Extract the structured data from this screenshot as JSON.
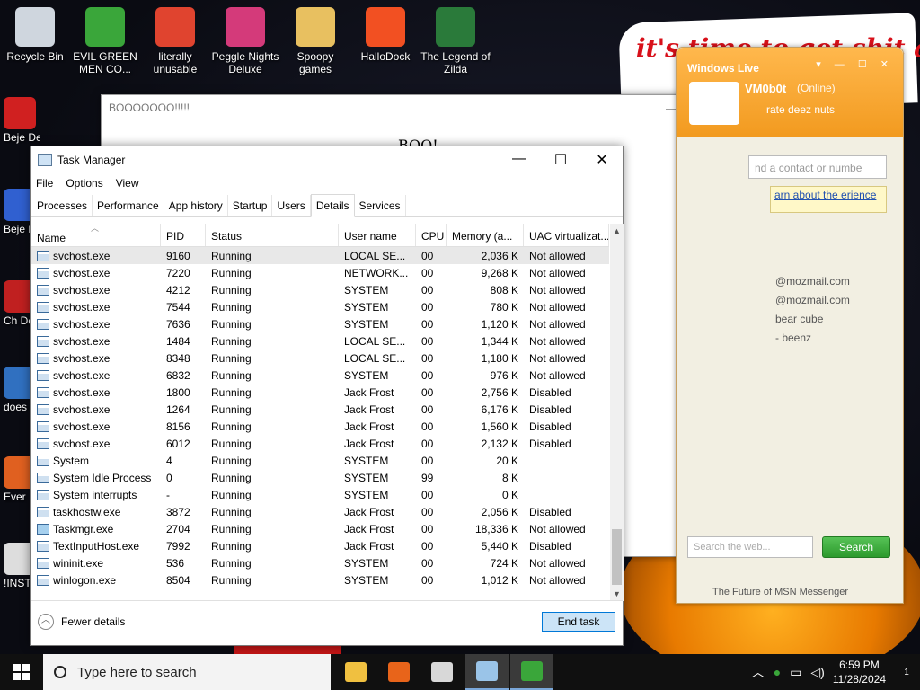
{
  "desktop": {
    "wallpaper_text": "it's time to get shit and",
    "icons": [
      {
        "label": "Recycle Bin",
        "icon": "recycle-bin-icon",
        "color": "#cfd6de"
      },
      {
        "label": "EVIL GREEN MEN CO...",
        "icon": "msn-buddies-icon",
        "color": "#3aa63a"
      },
      {
        "label": "literally unusable",
        "icon": "chrome-icon",
        "color": "#e0442f"
      },
      {
        "label": "Peggle Nights Deluxe",
        "icon": "peggle-icon",
        "color": "#d43a7a"
      },
      {
        "label": "Spoopy games",
        "icon": "folder-icon",
        "color": "#e8c060"
      },
      {
        "label": "HalloDock",
        "icon": "windows-logo-icon",
        "color": "#f25022"
      },
      {
        "label": "The Legend of Zilda",
        "icon": "zilda-icon",
        "color": "#2a7a3a"
      }
    ],
    "left_icons": [
      {
        "label": "Beje De",
        "icon": "bejeweled-icon",
        "color": "#d02020"
      },
      {
        "label": "Beje De",
        "icon": "bejeweled2-icon",
        "color": "#3060d0"
      },
      {
        "label": "Ch De",
        "icon": "chuzzle-icon",
        "color": "#c02020"
      },
      {
        "label": "does",
        "icon": "app-icon",
        "color": "#3070c0"
      },
      {
        "label": "Ever",
        "icon": "game-icon",
        "color": "#e06020"
      },
      {
        "label": "!INST",
        "icon": "installer-icon",
        "color": "#ddd"
      }
    ]
  },
  "boo_window": {
    "title": "BOOOOOOO!!!!!",
    "body": "BOO!",
    "controls": [
      "—",
      "☐",
      "✕"
    ]
  },
  "msn": {
    "brand": "Windows Live",
    "username": "VM0b0t",
    "status": "(Online)",
    "personal_message": "rate deez nuts",
    "search_placeholder": "nd a contact or numbe",
    "notice": "arn about the erience",
    "contacts": [
      "@mozmail.com",
      "@mozmail.com",
      "bear cube",
      "",
      "- beenz"
    ],
    "web_search_placeholder": "Search the web...",
    "search_button": "Search",
    "footer": "The Future of MSN Messenger"
  },
  "task_manager": {
    "title": "Task Manager",
    "menu": [
      "File",
      "Options",
      "View"
    ],
    "tabs": [
      "Processes",
      "Performance",
      "App history",
      "Startup",
      "Users",
      "Details",
      "Services"
    ],
    "active_tab": "Details",
    "columns": [
      "Name",
      "PID",
      "Status",
      "User name",
      "CPU",
      "Memory (a...",
      "UAC virtualizat..."
    ],
    "rows": [
      {
        "name": "svchost.exe",
        "pid": "9160",
        "status": "Running",
        "user": "LOCAL SE...",
        "cpu": "00",
        "mem": "2,036 K",
        "uac": "Not allowed",
        "selected": true
      },
      {
        "name": "svchost.exe",
        "pid": "7220",
        "status": "Running",
        "user": "NETWORK...",
        "cpu": "00",
        "mem": "9,268 K",
        "uac": "Not allowed"
      },
      {
        "name": "svchost.exe",
        "pid": "4212",
        "status": "Running",
        "user": "SYSTEM",
        "cpu": "00",
        "mem": "808 K",
        "uac": "Not allowed"
      },
      {
        "name": "svchost.exe",
        "pid": "7544",
        "status": "Running",
        "user": "SYSTEM",
        "cpu": "00",
        "mem": "780 K",
        "uac": "Not allowed"
      },
      {
        "name": "svchost.exe",
        "pid": "7636",
        "status": "Running",
        "user": "SYSTEM",
        "cpu": "00",
        "mem": "1,120 K",
        "uac": "Not allowed"
      },
      {
        "name": "svchost.exe",
        "pid": "1484",
        "status": "Running",
        "user": "LOCAL SE...",
        "cpu": "00",
        "mem": "1,344 K",
        "uac": "Not allowed"
      },
      {
        "name": "svchost.exe",
        "pid": "8348",
        "status": "Running",
        "user": "LOCAL SE...",
        "cpu": "00",
        "mem": "1,180 K",
        "uac": "Not allowed"
      },
      {
        "name": "svchost.exe",
        "pid": "6832",
        "status": "Running",
        "user": "SYSTEM",
        "cpu": "00",
        "mem": "976 K",
        "uac": "Not allowed"
      },
      {
        "name": "svchost.exe",
        "pid": "1800",
        "status": "Running",
        "user": "Jack Frost",
        "cpu": "00",
        "mem": "2,756 K",
        "uac": "Disabled"
      },
      {
        "name": "svchost.exe",
        "pid": "1264",
        "status": "Running",
        "user": "Jack Frost",
        "cpu": "00",
        "mem": "6,176 K",
        "uac": "Disabled"
      },
      {
        "name": "svchost.exe",
        "pid": "8156",
        "status": "Running",
        "user": "Jack Frost",
        "cpu": "00",
        "mem": "1,560 K",
        "uac": "Disabled"
      },
      {
        "name": "svchost.exe",
        "pid": "6012",
        "status": "Running",
        "user": "Jack Frost",
        "cpu": "00",
        "mem": "2,132 K",
        "uac": "Disabled"
      },
      {
        "name": "System",
        "pid": "4",
        "status": "Running",
        "user": "SYSTEM",
        "cpu": "00",
        "mem": "20 K",
        "uac": ""
      },
      {
        "name": "System Idle Process",
        "pid": "0",
        "status": "Running",
        "user": "SYSTEM",
        "cpu": "99",
        "mem": "8 K",
        "uac": ""
      },
      {
        "name": "System interrupts",
        "pid": "-",
        "status": "Running",
        "user": "SYSTEM",
        "cpu": "00",
        "mem": "0 K",
        "uac": ""
      },
      {
        "name": "taskhostw.exe",
        "pid": "3872",
        "status": "Running",
        "user": "Jack Frost",
        "cpu": "00",
        "mem": "2,056 K",
        "uac": "Disabled"
      },
      {
        "name": "Taskmgr.exe",
        "pid": "2704",
        "status": "Running",
        "user": "Jack Frost",
        "cpu": "00",
        "mem": "18,336 K",
        "uac": "Not allowed",
        "tm": true
      },
      {
        "name": "TextInputHost.exe",
        "pid": "7992",
        "status": "Running",
        "user": "Jack Frost",
        "cpu": "00",
        "mem": "5,440 K",
        "uac": "Disabled"
      },
      {
        "name": "wininit.exe",
        "pid": "536",
        "status": "Running",
        "user": "SYSTEM",
        "cpu": "00",
        "mem": "724 K",
        "uac": "Not allowed"
      },
      {
        "name": "winlogon.exe",
        "pid": "8504",
        "status": "Running",
        "user": "SYSTEM",
        "cpu": "00",
        "mem": "1,012 K",
        "uac": "Not allowed"
      }
    ],
    "fewer_details": "Fewer details",
    "end_task": "End task"
  },
  "taskbar": {
    "search_placeholder": "Type here to search",
    "pinned": [
      {
        "icon": "file-explorer-icon",
        "color": "#f0c040"
      },
      {
        "icon": "firefox-icon",
        "color": "#e8641a"
      },
      {
        "icon": "cmd-window-icon",
        "color": "#d8d8d8"
      },
      {
        "icon": "task-manager-icon",
        "color": "#9ac4e8",
        "active": true
      },
      {
        "icon": "msn-messenger-icon",
        "color": "#3aa63a",
        "active": true
      }
    ],
    "time": "6:59 PM",
    "date": "11/28/2024",
    "notifications": "1"
  }
}
